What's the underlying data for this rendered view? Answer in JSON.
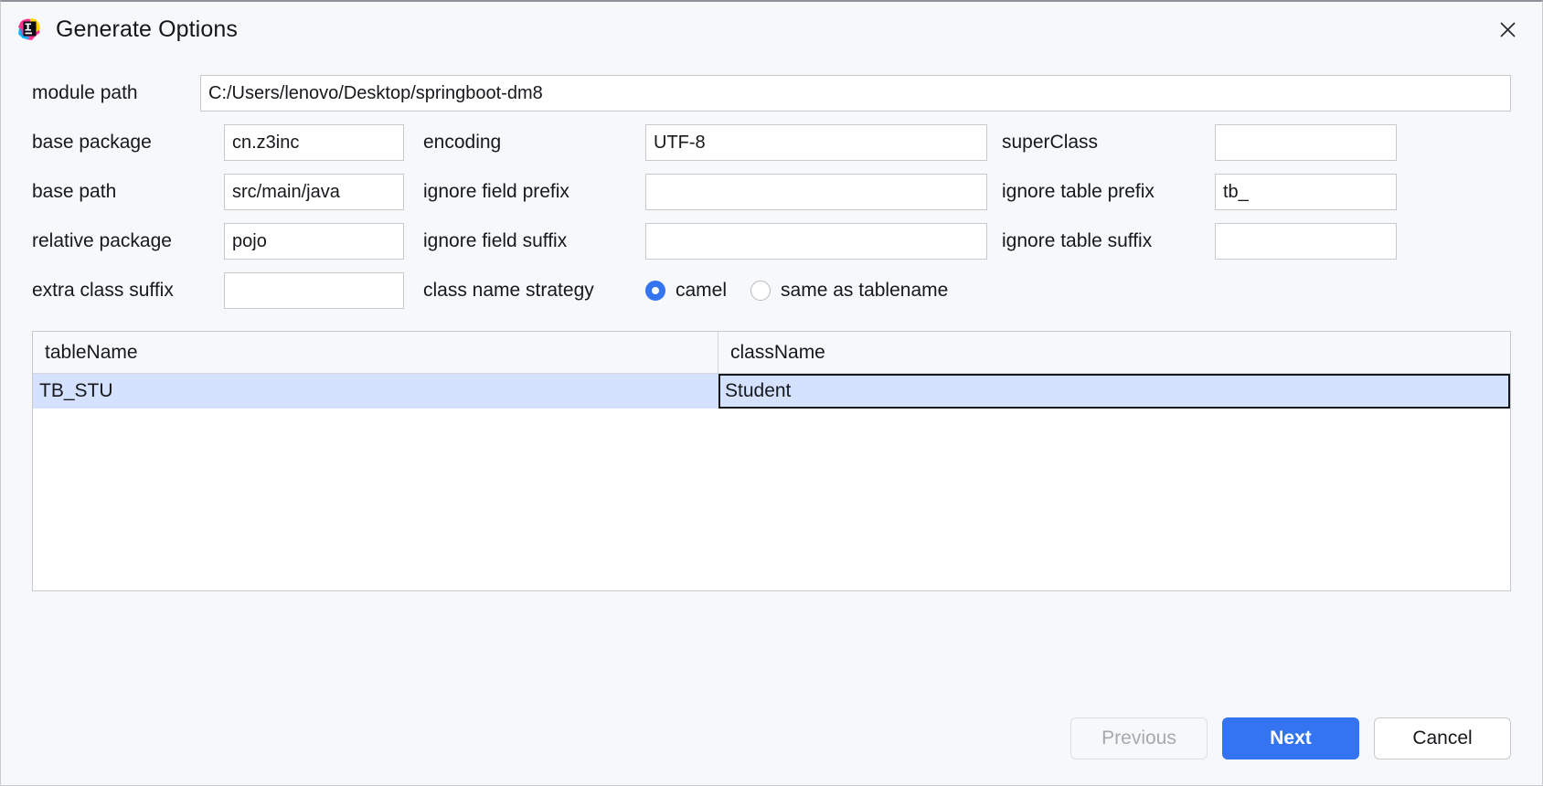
{
  "window": {
    "title": "Generate Options",
    "app_icon": "intellij-idea-icon",
    "close_label": "✕"
  },
  "form": {
    "module_path": {
      "label": "module path",
      "value": "C:/Users/lenovo/Desktop/springboot-dm8",
      "placeholder": ""
    },
    "base_package": {
      "label": "base package",
      "value": "cn.z3inc",
      "placeholder": ""
    },
    "encoding": {
      "label": "encoding",
      "value": "UTF-8",
      "placeholder": ""
    },
    "super_class": {
      "label": "superClass",
      "value": "",
      "placeholder": ""
    },
    "base_path": {
      "label": "base path",
      "value": "src/main/java",
      "placeholder": ""
    },
    "ignore_field_prefix": {
      "label": "ignore field prefix",
      "value": "",
      "placeholder": ""
    },
    "ignore_table_prefix": {
      "label": "ignore table prefix",
      "value": "tb_",
      "placeholder": ""
    },
    "relative_package": {
      "label": "relative package",
      "value": "pojo",
      "placeholder": ""
    },
    "ignore_field_suffix": {
      "label": "ignore field suffix",
      "value": "",
      "placeholder": ""
    },
    "ignore_table_suffix": {
      "label": "ignore table suffix",
      "value": "",
      "placeholder": ""
    },
    "extra_class_suffix": {
      "label": "extra class suffix",
      "value": "",
      "placeholder": ""
    },
    "class_name_strategy": {
      "label": "class name strategy",
      "selected": "camel",
      "options": [
        {
          "value": "camel",
          "label": "camel",
          "checked": true
        },
        {
          "value": "same_as_tablename",
          "label": "same as tablename",
          "checked": false
        }
      ]
    }
  },
  "table": {
    "columns": [
      "tableName",
      "className"
    ],
    "rows": [
      {
        "tableName": "TB_STU",
        "className": "Student",
        "selected": true,
        "editing_cell": "className"
      }
    ]
  },
  "footer": {
    "previous": "Previous",
    "next": "Next",
    "cancel": "Cancel"
  },
  "colors": {
    "accent": "#3574f0",
    "selection": "#d4e2ff",
    "background": "#f7f8fa",
    "field_background": "#ffffff",
    "border": "#c6c9ce",
    "disabled_text": "#a6a9af"
  }
}
